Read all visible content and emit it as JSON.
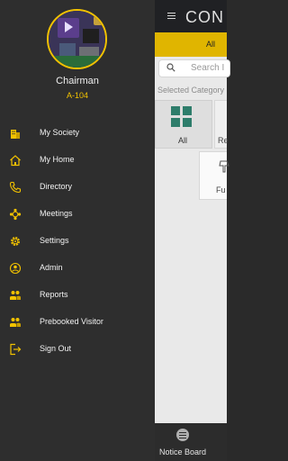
{
  "background": {
    "header_title": "CON",
    "tab_all": "All",
    "search_placeholder": "Search I",
    "selected_category": "Selected Category",
    "cards": [
      {
        "label": "All"
      },
      {
        "label": "Re"
      },
      {
        "label": "Fu"
      }
    ],
    "bottom_nav": {
      "label": "Notice Board"
    }
  },
  "drawer": {
    "profile": {
      "role": "Chairman",
      "unit": "A-104"
    },
    "menu": [
      {
        "label": "My Society",
        "icon": "society-icon"
      },
      {
        "label": "My Home",
        "icon": "home-icon"
      },
      {
        "label": "Directory",
        "icon": "phone-icon"
      },
      {
        "label": "Meetings",
        "icon": "meetings-icon"
      },
      {
        "label": "Settings",
        "icon": "gear-icon"
      },
      {
        "label": "Admin",
        "icon": "admin-icon"
      },
      {
        "label": "Reports",
        "icon": "reports-icon"
      },
      {
        "label": "Prebooked Visitor",
        "icon": "visitor-icon"
      },
      {
        "label": "Sign Out",
        "icon": "sign-out-icon"
      }
    ]
  },
  "colors": {
    "accent": "#f2c200",
    "drawer_bg": "#2e2e2e",
    "topbar_bg": "#202124"
  }
}
